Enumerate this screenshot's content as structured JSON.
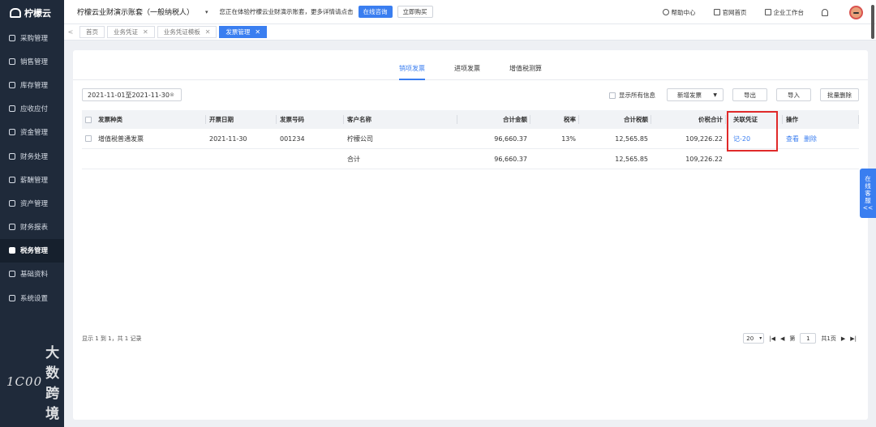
{
  "brand": {
    "name": "柠檬云"
  },
  "sidebar": {
    "items": [
      {
        "label": "采购管理",
        "icon": "cart-icon"
      },
      {
        "label": "销售管理",
        "icon": "sales-icon"
      },
      {
        "label": "库存管理",
        "icon": "warehouse-icon"
      },
      {
        "label": "应收应付",
        "icon": "receivable-icon"
      },
      {
        "label": "资金管理",
        "icon": "funds-icon"
      },
      {
        "label": "财务处理",
        "icon": "accounting-icon"
      },
      {
        "label": "薪酬管理",
        "icon": "salary-icon"
      },
      {
        "label": "资产管理",
        "icon": "asset-icon"
      },
      {
        "label": "财务报表",
        "icon": "report-icon"
      },
      {
        "label": "税务管理",
        "icon": "tax-icon",
        "active": true
      },
      {
        "label": "基础资料",
        "icon": "basic-data-icon"
      },
      {
        "label": "系统设置",
        "icon": "settings-icon"
      }
    ]
  },
  "watermark": {
    "mark": "1C00",
    "text": "大数跨境"
  },
  "topbar": {
    "account": "柠檬云业财演示账套（一般纳税人）",
    "caret": "▾",
    "notice": "您正在体验柠檬云业财演示账套，更多详情请点击",
    "consult": "在线咨询",
    "buy": "立即购买",
    "help": "帮助中心",
    "official_site": "官网首页",
    "workbench": "企业工作台"
  },
  "tabs": {
    "items": [
      {
        "label": "首页",
        "closable": false
      },
      {
        "label": "业务凭证",
        "closable": true
      },
      {
        "label": "业务凭证模板",
        "closable": true
      },
      {
        "label": "发票管理",
        "closable": true,
        "active": true
      }
    ],
    "close_glyph": "✕"
  },
  "subtabs": [
    "销项发票",
    "进项发票",
    "增值税测算"
  ],
  "filters": {
    "date_range": "2021-11-01至2021-11-30",
    "clear_glyph": "⊗",
    "show_all": "显示所有信息",
    "new_invoice": "新增发票",
    "export": "导出",
    "import": "导入",
    "batch_delete": "批量删除"
  },
  "table": {
    "headers": {
      "type": "发票种类",
      "date": "开票日期",
      "number": "发票号码",
      "customer": "客户名称",
      "amount": "合计金额",
      "rate": "税率",
      "tax": "合计税额",
      "total": "价税合计",
      "voucher": "关联凭证",
      "ops": "操作"
    },
    "rows": [
      {
        "type": "增值税普通发票",
        "date": "2021-11-30",
        "number": "001234",
        "customer": "柠檬公司",
        "amount": "96,660.37",
        "rate": "13%",
        "tax": "12,565.85",
        "total": "109,226.22",
        "voucher": "记-20",
        "view": "查看",
        "delete": "删除"
      }
    ],
    "summary": {
      "label": "合计",
      "amount": "96,660.37",
      "tax": "12,565.85",
      "total": "109,226.22"
    }
  },
  "footer": {
    "info": "显示 1 到 1，共 1 记录",
    "page_size": "20",
    "page_prefix": "第",
    "page": "1",
    "page_suffix": "共1页"
  },
  "float_service": {
    "chars": [
      "在",
      "线",
      "客",
      "服"
    ],
    "collapse": "<<"
  },
  "colors": {
    "sidebar": "#1f2a3a",
    "accent": "#3a7ef0",
    "highlight": "#e02a2a"
  }
}
